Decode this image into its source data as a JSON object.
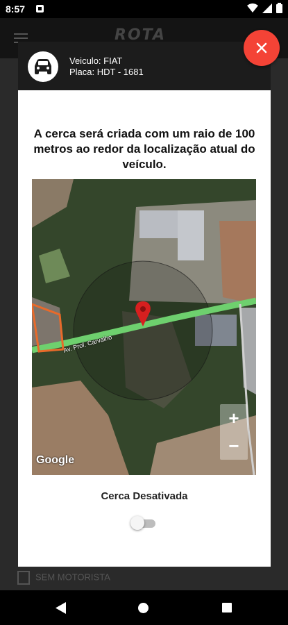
{
  "status_bar": {
    "time": "8:57",
    "icons": [
      "notification-icon",
      "wifi-icon",
      "signal-icon",
      "battery-icon"
    ]
  },
  "background_app": {
    "logo_text": "ROTA",
    "row_label": "SEM MOTORISTA"
  },
  "dialog": {
    "vehicle_label": "Veiculo: FIAT",
    "plate_label": "Placa: HDT - 1681",
    "message": "A cerca será criada com um raio de 100 metros ao redor da localização atual do veículo.",
    "map": {
      "street_name": "Av. Prof. Carvalho",
      "provider": "Google",
      "zoom_in": "+",
      "zoom_out": "−"
    },
    "fence_status": "Cerca Desativada",
    "fence_toggle_on": false
  },
  "colors": {
    "close_button": "#f44336",
    "header": "#1c1c1c",
    "route": "#6ed06e",
    "pin": "#d71f1f"
  },
  "nav_bar": {
    "icons": [
      "back-icon",
      "home-icon",
      "recent-apps-icon"
    ]
  }
}
